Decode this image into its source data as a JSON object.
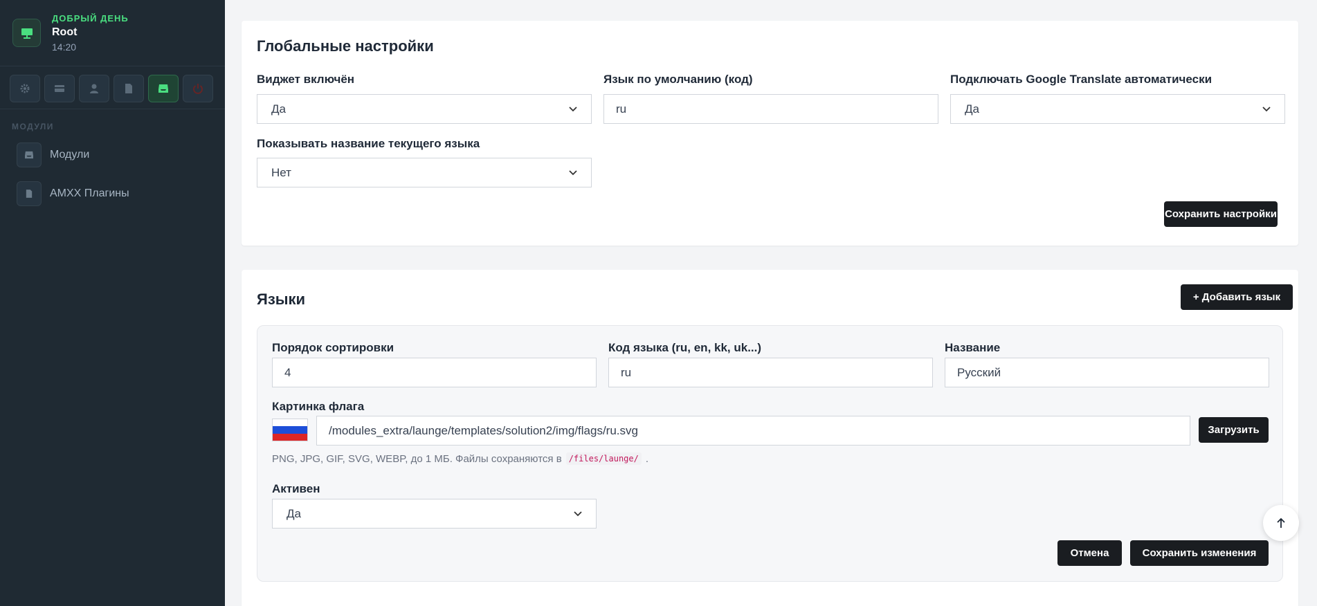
{
  "sidebar": {
    "greeting": "ДОБРЫЙ ДЕНЬ",
    "user_name": "Root",
    "time": "14:20",
    "tools": [
      {
        "icon": "gear-icon"
      },
      {
        "icon": "card-icon"
      },
      {
        "icon": "user-icon"
      },
      {
        "icon": "file-icon"
      },
      {
        "icon": "inbox-icon",
        "active": true
      },
      {
        "icon": "power-icon"
      }
    ],
    "section_label": "МОДУЛИ",
    "items": [
      {
        "label": "Модули",
        "icon": "inbox-icon"
      },
      {
        "label": "AMXX Плагины",
        "icon": "file-icon"
      }
    ]
  },
  "global_settings": {
    "title": "Глобальные настройки",
    "widget_enabled": {
      "label": "Виджет включён",
      "value": "Да"
    },
    "default_lang": {
      "label": "Язык по умолчанию (код)",
      "value": "ru"
    },
    "google_translate": {
      "label": "Подключать Google Translate автоматически",
      "value": "Да"
    },
    "show_lang_name": {
      "label": "Показывать название текущего языка",
      "value": "Нет"
    },
    "save_label": "Сохранить настройки"
  },
  "languages": {
    "title": "Языки",
    "add_label": "+ Добавить язык",
    "sort_order": {
      "label": "Порядок сортировки",
      "value": "4"
    },
    "lang_code": {
      "label": "Код языка (ru, en, kk, uk...)",
      "value": "ru"
    },
    "name": {
      "label": "Название",
      "value": "Русский"
    },
    "flag": {
      "label": "Картинка флага",
      "path": "/modules_extra/launge/templates/solution2/img/flags/ru.svg",
      "upload_label": "Загрузить"
    },
    "hint_text": "PNG, JPG, GIF, SVG, WEBP, до 1 МБ. Файлы сохраняются в",
    "hint_code": "/files/launge/",
    "hint_end": ".",
    "active": {
      "label": "Активен",
      "value": "Да"
    },
    "cancel_label": "Отмена",
    "save_label": "Сохранить изменения"
  },
  "colors": {
    "accent": "#4ade80",
    "sidebar_bg": "#1f2a33",
    "button_dark": "#1a1d21",
    "power": "#7f1d1d"
  }
}
